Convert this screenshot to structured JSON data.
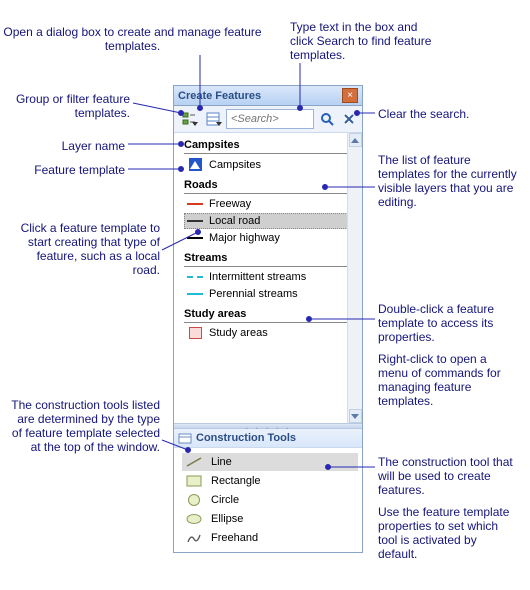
{
  "panel": {
    "title": "Create Features"
  },
  "toolbar": {
    "search_placeholder": "<Search>"
  },
  "groups": [
    {
      "label": "Campsites",
      "items": [
        {
          "name": "Campsites",
          "symbol": "point-tri",
          "color": "#2157c9"
        }
      ]
    },
    {
      "label": "Roads",
      "items": [
        {
          "name": "Freeway",
          "symbol": "line",
          "color": "#d83a1f"
        },
        {
          "name": "Local road",
          "symbol": "line",
          "color": "#333333",
          "selected": true
        },
        {
          "name": "Major highway",
          "symbol": "line",
          "color": "#000000"
        }
      ]
    },
    {
      "label": "Streams",
      "items": [
        {
          "name": "Intermittent streams",
          "symbol": "dash",
          "color": "#1fbad6"
        },
        {
          "name": "Perennial streams",
          "symbol": "line",
          "color": "#1fbad6"
        }
      ]
    },
    {
      "label": "Study areas",
      "items": [
        {
          "name": "Study areas",
          "symbol": "poly",
          "color": "#fbdada"
        }
      ]
    }
  ],
  "construction": {
    "title": "Construction Tools",
    "tools": [
      {
        "name": "Line",
        "icon": "line",
        "selected": true
      },
      {
        "name": "Rectangle",
        "icon": "rect"
      },
      {
        "name": "Circle",
        "icon": "circle"
      },
      {
        "name": "Ellipse",
        "icon": "ellipse"
      },
      {
        "name": "Freehand",
        "icon": "freehand"
      }
    ]
  },
  "annotations": {
    "open_dialog": "Open a dialog box to create and manage feature templates.",
    "type_search": "Type text in the box and click Search to find feature templates.",
    "group_filter": "Group or filter feature templates.",
    "clear_search": "Clear the search.",
    "layer_name": "Layer name",
    "feature_template": "Feature template",
    "click_template": "Click a feature template to start creating that type of feature, such as a local road.",
    "list_desc": "The list of feature templates for the currently visible layers that you are editing.",
    "dbl_click": "Double-click a feature template to access its properties.",
    "right_click": "Right-click to open a menu of commands for managing feature templates.",
    "constr_desc": "The construction tools listed are determined by the type of feature template selected at the top of the window.",
    "constr_tool": "The construction tool that will be used to create features.",
    "constr_default": "Use the feature template properties to set which tool is activated by default."
  }
}
